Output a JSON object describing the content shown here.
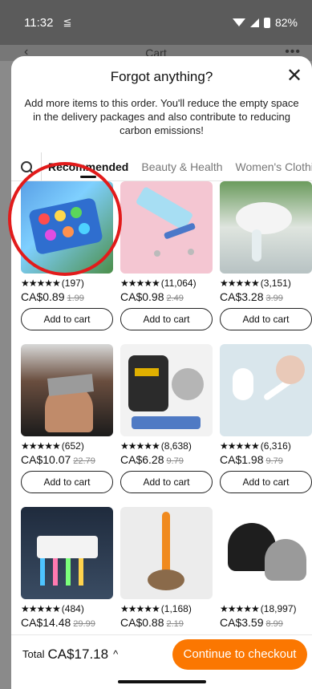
{
  "statusbar": {
    "time": "11:32",
    "notif": "≦",
    "battery": "82%"
  },
  "behind": {
    "title": "Cart",
    "back": "‹",
    "more": "•••"
  },
  "sheet": {
    "title": "Forgot anything?",
    "close": "✕",
    "description": "Add more items to this order. You'll reduce the empty space in the delivery packages and also contribute to reducing carbon emissions!"
  },
  "tabs": [
    "Recommended",
    "Beauty & Health",
    "Women's Clothing"
  ],
  "products": [
    {
      "stars": "★★★★★",
      "reviews": "(197)",
      "price": "CA$0.89",
      "old_price": "1.99",
      "button": "Add to cart"
    },
    {
      "stars": "★★★★★",
      "reviews": "(11,064)",
      "price": "CA$0.98",
      "old_price": "2.49",
      "button": "Add to cart"
    },
    {
      "stars": "★★★★★",
      "reviews": "(3,151)",
      "price": "CA$3.28",
      "old_price": "3.99",
      "button": "Add to cart"
    },
    {
      "stars": "★★★★★",
      "reviews": "(652)",
      "price": "CA$10.07",
      "old_price": "22.79",
      "button": "Add to cart"
    },
    {
      "stars": "★★★★★",
      "reviews": "(8,638)",
      "price": "CA$6.28",
      "old_price": "9.79",
      "button": "Add to cart"
    },
    {
      "stars": "★★★★★",
      "reviews": "(6,316)",
      "price": "CA$1.98",
      "old_price": "9.79",
      "button": "Add to cart"
    },
    {
      "stars": "★★★★★",
      "reviews": "(484)",
      "price": "CA$14.48",
      "old_price": "29.99",
      "button": "Add to cart"
    },
    {
      "stars": "★★★★★",
      "reviews": "(1,168)",
      "price": "CA$0.88",
      "old_price": "2.19",
      "button": "Add to cart"
    },
    {
      "stars": "★★★★★",
      "reviews": "(18,997)",
      "price": "CA$3.59",
      "old_price": "8.99",
      "button": "Add to cart"
    }
  ],
  "footer": {
    "total_label": "Total",
    "total_value": "CA$17.18",
    "chevron": "^",
    "checkout": "Continue to checkout"
  },
  "colors": {
    "accent": "#fb7701",
    "highlight_circle": "#e21b1b"
  }
}
